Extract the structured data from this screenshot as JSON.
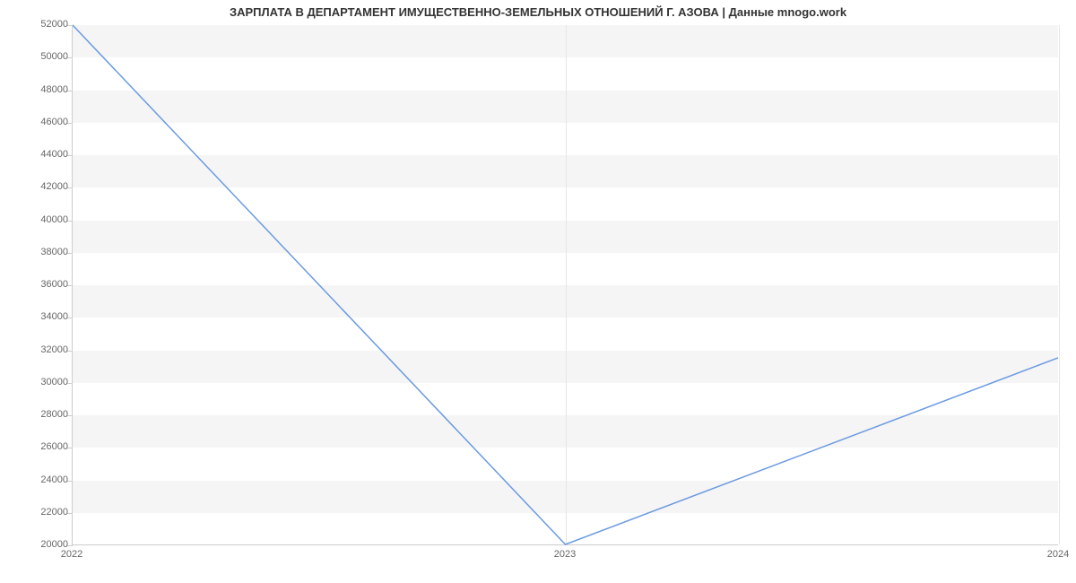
{
  "chart_data": {
    "type": "line",
    "title": "ЗАРПЛАТА В ДЕПАРТАМЕНТ ИМУЩЕСТВЕННО-ЗЕМЕЛЬНЫХ ОТНОШЕНИЙ Г. АЗОВА | Данные mnogo.work",
    "x": [
      2022,
      2023,
      2024
    ],
    "series": [
      {
        "name": "Зарплата",
        "values": [
          52000,
          20000,
          31500
        ],
        "color": "#6b9ae0"
      }
    ],
    "xlabel": "",
    "ylabel": "",
    "ylim": [
      20000,
      52000
    ],
    "y_ticks": [
      20000,
      22000,
      24000,
      26000,
      28000,
      30000,
      32000,
      34000,
      36000,
      38000,
      40000,
      42000,
      44000,
      46000,
      48000,
      50000,
      52000
    ],
    "x_ticks": [
      2022,
      2023,
      2024
    ]
  }
}
